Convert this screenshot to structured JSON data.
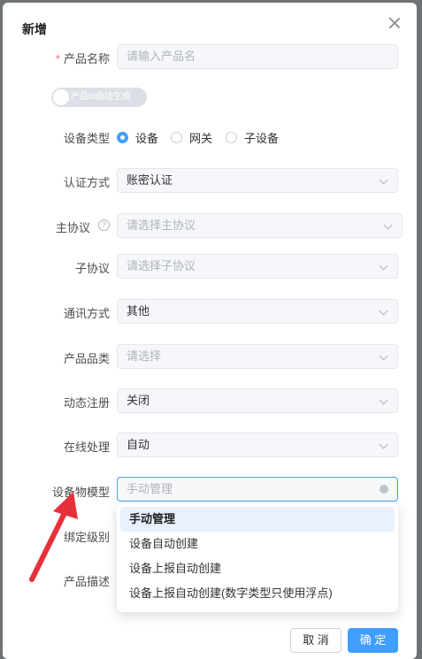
{
  "dialog": {
    "title": "新增"
  },
  "form": {
    "product_name": {
      "label": "产品名称",
      "required_mark": "*",
      "placeholder": "请输入产品名"
    },
    "auto_id_switch": {
      "label": "产品id自动生成"
    },
    "device_type": {
      "label": "设备类型",
      "options": [
        "设备",
        "网关",
        "子设备"
      ],
      "selected": "设备"
    },
    "auth_method": {
      "label": "认证方式",
      "value": "账密认证"
    },
    "main_protocol": {
      "label": "主协议",
      "help": "?",
      "placeholder": "请选择主协议"
    },
    "sub_protocol": {
      "label": "子协议",
      "placeholder": "请选择子协议"
    },
    "comm_method": {
      "label": "通讯方式",
      "value": "其他"
    },
    "category": {
      "label": "产品品类",
      "placeholder": "请选择"
    },
    "dynamic_register": {
      "label": "动态注册",
      "value": "关闭"
    },
    "online_handling": {
      "label": "在线处理",
      "value": "自动"
    },
    "device_model": {
      "label": "设备物模型",
      "value": "手动管理"
    },
    "bind_level": {
      "label": "绑定级别"
    },
    "product_desc": {
      "label": "产品描述"
    }
  },
  "dropdown": {
    "options": [
      "手动管理",
      "设备自动创建",
      "设备上报自动创建",
      "设备上报自动创建(数字类型只使用浮点)"
    ],
    "selected": "手动管理"
  },
  "footer": {
    "cancel_label": "取 消",
    "confirm_label": "确 定"
  },
  "colors": {
    "primary": "#409eff",
    "required": "#f56c6c",
    "annotation_arrow": "#e8303a"
  }
}
